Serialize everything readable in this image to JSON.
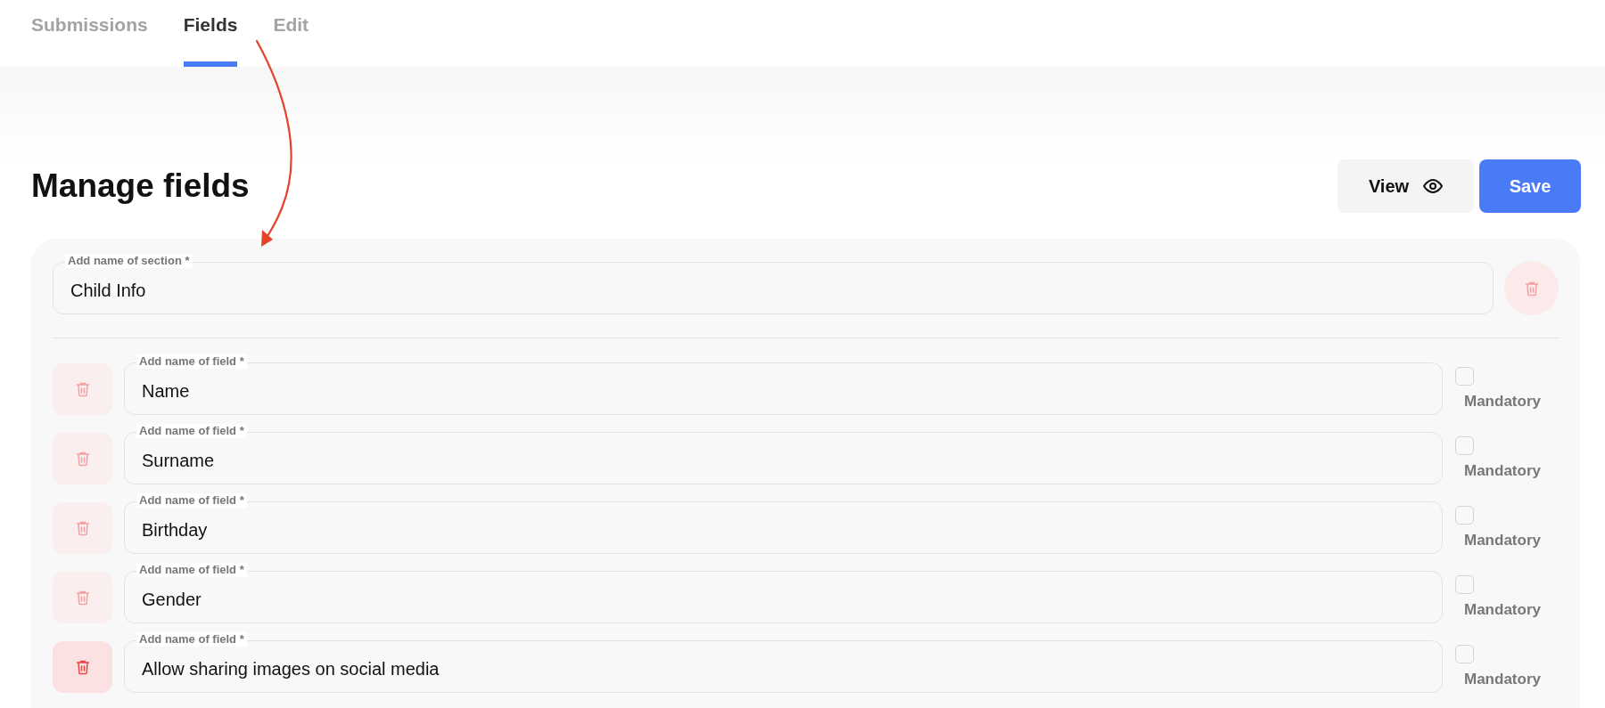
{
  "tabs": [
    {
      "label": "Submissions",
      "selected": false
    },
    {
      "label": "Fields",
      "selected": true
    },
    {
      "label": "Edit",
      "selected": false
    }
  ],
  "title": "Manage fields",
  "actions": {
    "view": "View",
    "save": "Save"
  },
  "section": {
    "label": "Add name of section *",
    "value": "Child Info"
  },
  "fields": [
    {
      "label": "Add name of field *",
      "value": "Name",
      "mandatory_label": "Mandatory",
      "checked": false,
      "disabled": true
    },
    {
      "label": "Add name of field *",
      "value": "Surname",
      "mandatory_label": "Mandatory",
      "checked": false,
      "disabled": true
    },
    {
      "label": "Add name of field *",
      "value": "Birthday",
      "mandatory_label": "Mandatory",
      "checked": false,
      "disabled": true
    },
    {
      "label": "Add name of field *",
      "value": "Gender",
      "mandatory_label": "Mandatory",
      "checked": false,
      "disabled": true
    },
    {
      "label": "Add name of field *",
      "value": "Allow sharing images on social media",
      "mandatory_label": "Mandatory",
      "checked": false,
      "disabled": false
    }
  ]
}
